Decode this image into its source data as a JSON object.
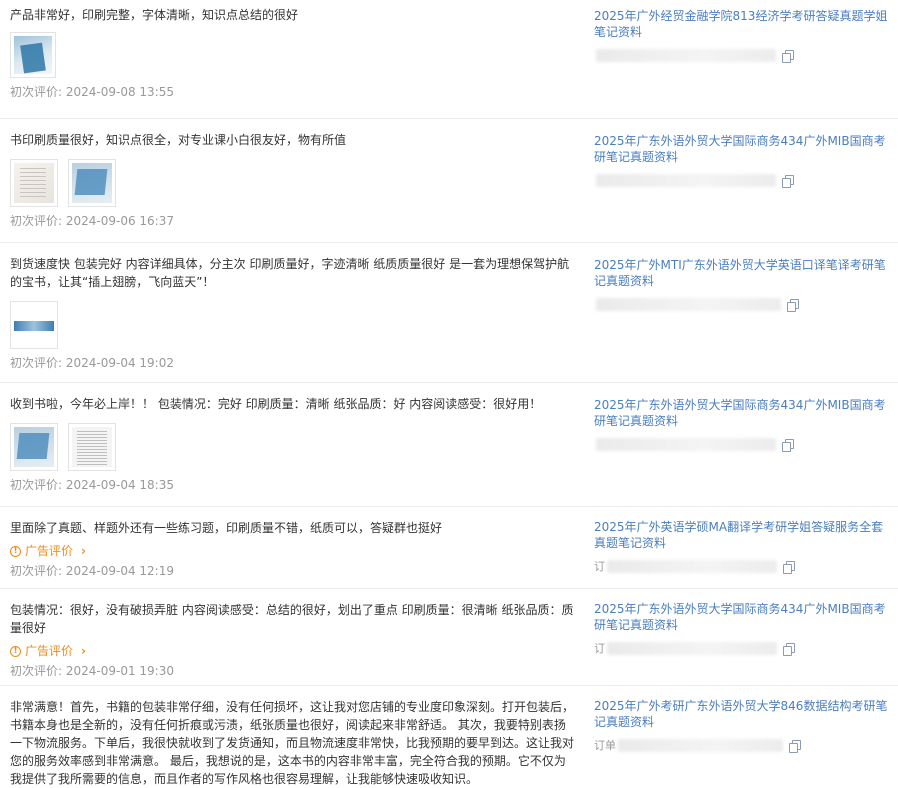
{
  "reviews": [
    {
      "content": "产品非常好，印刷完整，字体清晰，知识点总结的很好",
      "thumbs": [
        "t-blue"
      ],
      "date": "初次评价: 2024-09-08 13:55",
      "product_title": "2025年广外经贸金融学院813经济学考研答疑真题学姐笔记资料",
      "order_prefix": ""
    },
    {
      "content": "书印刷质量很好，知识点很全，对专业课小白很友好，物有所值",
      "thumbs": [
        "t-paper",
        "t-book"
      ],
      "date": "初次评价: 2024-09-06 16:37",
      "product_title": "2025年广东外语外贸大学国际商务434广外MIB国商考研笔记真题资料",
      "order_prefix": ""
    },
    {
      "content": "到货速度快 包装完好 内容详细具体，分主次 印刷质量好，字迹清晰 纸质质量很好 是一套为理想保驾护航的宝书，让其“插上翅膀，飞向蓝天”！",
      "thumbs": [
        "t-strip"
      ],
      "date": "初次评价: 2024-09-04 19:02",
      "product_title": "2025年广外MTI广东外语外贸大学英语口译笔译考研笔记真题资料",
      "order_prefix": ""
    },
    {
      "content": "收到书啦，今年必上岸！！ 包装情况：完好 印刷质量：清晰 纸张品质：好 内容阅读感受：很好用！",
      "thumbs": [
        "t-book",
        "t-text"
      ],
      "date": "初次评价: 2024-09-04 18:35",
      "product_title": "2025年广东外语外贸大学国际商务434广外MIB国商考研笔记真题资料",
      "order_prefix": ""
    },
    {
      "content": "里面除了真题、样题外还有一些练习题，印刷质量不错，纸质可以，答疑群也挺好",
      "ad": "广告评价",
      "date": "初次评价: 2024-09-04 12:19",
      "product_title": "2025年广外英语学硕MA翻译学考研学姐答疑服务全套真题笔记资料",
      "order_prefix": "订"
    },
    {
      "content": "包装情况：很好，没有破损弄脏 内容阅读感受：总结的很好，划出了重点 印刷质量：很清晰 纸张品质：质量很好",
      "ad": "广告评价",
      "date": "初次评价: 2024-09-01 19:30",
      "product_title": "2025年广东外语外贸大学国际商务434广外MIB国商考研笔记真题资料",
      "order_prefix": "订"
    },
    {
      "content": "非常满意！首先，书籍的包装非常仔细，没有任何损坏，这让我对您店铺的专业度印象深刻。打开包装后，书籍本身也是全新的，没有任何折痕或污渍，纸张质量也很好，阅读起来非常舒适。 其次，我要特别表扬一下物流服务。下单后，我很快就收到了发货通知，而且物流速度非常快，比我预期的要早到达。这让我对您的服务效率感到非常满意。 最后，我想说的是，这本书的内容非常丰富，完全符合我的预期。它不仅为我提供了我所需要的信息，而且作者的写作风格也很容易理解，让我能够快速吸收知识。",
      "date": "",
      "product_title": "2025年广外考研广东外语外贸大学846数据结构考研笔记真题资料",
      "order_prefix": "订单"
    }
  ]
}
